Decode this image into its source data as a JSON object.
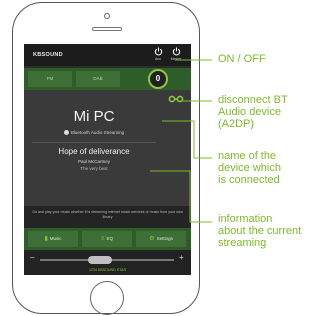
{
  "app": {
    "brand": "KBSOUND",
    "power_aux_label": "Aux",
    "power_master_label": "Master"
  },
  "tabs": [
    {
      "label": "FM"
    },
    {
      "label": "DAB"
    },
    {
      "label": "0"
    }
  ],
  "player": {
    "device_name": "Mi PC",
    "profile": "Bluetooth Audio Streaming",
    "song_title": "Hope of deliverance",
    "artist": "Paul McCartney",
    "album": "The very best"
  },
  "info_text": "Go and play your music whether it is streaming internet music services or music from your own library",
  "actions": [
    {
      "label": "Music"
    },
    {
      "label": "EQ"
    },
    {
      "label": "Settings"
    }
  ],
  "volume": {
    "minus": "–",
    "plus": "+",
    "level": 0.45
  },
  "footer_text": "1234 KBSOUND STAR",
  "annotations": {
    "on_off": "ON / OFF",
    "disconnect_line1": "disconnect BT",
    "disconnect_line2": "Audio device",
    "disconnect_line3": "(A2DP)",
    "device_line1": "name of the",
    "device_line2": "device which",
    "device_line3": "is connected",
    "info_line1": "information",
    "info_line2": "about the current",
    "info_line3": "streaming"
  },
  "colors": {
    "accent": "#7dbb2b",
    "bar_green": "#2f5d2a",
    "screen_bg": "#3a3a3a"
  }
}
